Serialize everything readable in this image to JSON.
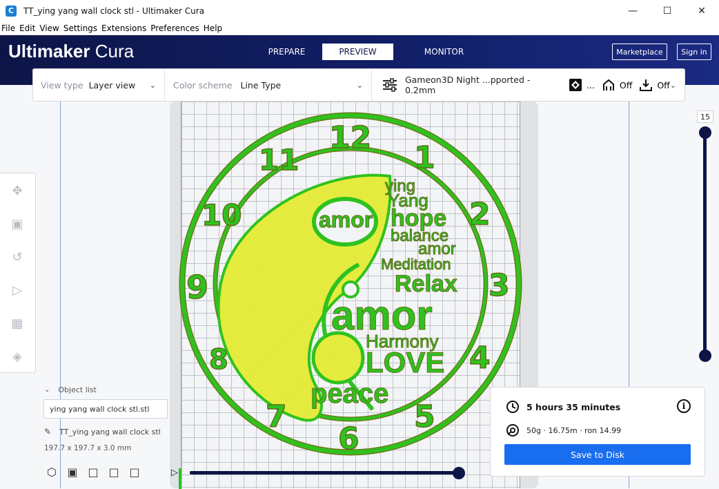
{
  "window": {
    "title": "TT_ying yang wall clock stl - Ultimaker Cura",
    "app_icon": "C",
    "controls": {
      "minimize": "—",
      "maximize": "☐",
      "close": "✕"
    }
  },
  "menu": [
    "File",
    "Edit",
    "View",
    "Settings",
    "Extensions",
    "Preferences",
    "Help"
  ],
  "header": {
    "brand_bold": "Ultimaker",
    "brand_light": "Cura",
    "stages": {
      "prepare": "PREPARE",
      "preview": "PREVIEW",
      "monitor": "MONITOR"
    },
    "marketplace": "Marketplace",
    "signin": "Sign in"
  },
  "toolpanel": {
    "view_type_label": "View type",
    "view_type_value": "Layer view",
    "color_scheme_label": "Color scheme",
    "color_scheme_value": "Line Type",
    "profile": "Gameon3D Night ...pported - 0.2mm",
    "infill_ellipsis": "...",
    "support_value": "Off",
    "adhesion_value": "Off"
  },
  "model": {
    "numbers": [
      "12",
      "1",
      "2",
      "3",
      "4",
      "5",
      "6",
      "7",
      "8",
      "9",
      "10",
      "11"
    ],
    "words": [
      "ying",
      "Yang",
      "hope",
      "balance",
      "amor",
      "Meditation",
      "Relax",
      "amor",
      "Harmony",
      "LOVE",
      "peace",
      "amor"
    ],
    "colors": {
      "wall": "#2fc21f",
      "wall_dark": "#6b7a1a",
      "infill": "#e9ef3f"
    }
  },
  "object_list": {
    "header": "Object list",
    "input_value": "ying yang wall clock stl.stl",
    "object_name": "TT_ying yang wall clock stl",
    "dimensions": "197.7 x 197.7 x 3.0 mm"
  },
  "layer": {
    "current": "15"
  },
  "print": {
    "time": "5 hours 35 minutes",
    "material": "50g · 16.75m · ron 14.99",
    "save_label": "Save to Disk",
    "info_icon": "i"
  },
  "colors": {
    "header_dark": "#0d1547",
    "accent_blue": "#196ef0",
    "title_bar": "#ffffff"
  }
}
